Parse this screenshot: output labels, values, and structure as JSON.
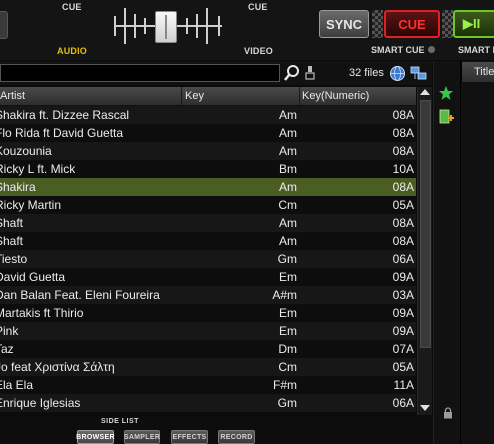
{
  "deck": {
    "cue_left_label": "CUE",
    "cue_right_label": "CUE",
    "audio_label": "AUDIO",
    "video_label": "VIDEO",
    "sync_label": "SYNC",
    "cue_button_label": "CUE",
    "play_button_label": "▶II",
    "smart_cue_label": "SMART CUE",
    "smart_cue_label_right": "SMART I",
    "colors": {
      "cue_red": "#e02020",
      "play_green": "#6cc82a",
      "audio_yellow": "#e8c000"
    }
  },
  "browser": {
    "search": {
      "value": "",
      "placeholder": ""
    },
    "files_count": "32 files",
    "columns": [
      "Artist",
      "Key",
      "Key(Numeric)"
    ],
    "rows": [
      {
        "artist": "Shakira ft. Dizzee Rascal",
        "key": "Am",
        "key_numeric": "08A"
      },
      {
        "artist": "Flo Rida ft David Guetta",
        "key": "Am",
        "key_numeric": "08A"
      },
      {
        "artist": "Kouzounia",
        "key": "Am",
        "key_numeric": "08A"
      },
      {
        "artist": "Ricky L ft. Mick",
        "key": "Bm",
        "key_numeric": "10A"
      },
      {
        "artist": "Shakira",
        "key": "Am",
        "key_numeric": "08A"
      },
      {
        "artist": "Ricky Martin",
        "key": "Cm",
        "key_numeric": "05A"
      },
      {
        "artist": "Shaft",
        "key": "Am",
        "key_numeric": "08A"
      },
      {
        "artist": "Shaft",
        "key": "Am",
        "key_numeric": "08A"
      },
      {
        "artist": "Tiesto",
        "key": "Gm",
        "key_numeric": "06A"
      },
      {
        "artist": "David Guetta",
        "key": "Em",
        "key_numeric": "09A"
      },
      {
        "artist": "Dan Balan Feat. Eleni Foureira",
        "key": "A#m",
        "key_numeric": "03A"
      },
      {
        "artist": "Martakis ft Thirio",
        "key": "Em",
        "key_numeric": "09A"
      },
      {
        "artist": "Pink",
        "key": "Em",
        "key_numeric": "09A"
      },
      {
        "artist": "Taz",
        "key": "Dm",
        "key_numeric": "07A"
      },
      {
        "artist": "Jo feat Χριστίνα Σάλτη",
        "key": "Cm",
        "key_numeric": "05A"
      },
      {
        "artist": "Ela Ela",
        "key": "F#m",
        "key_numeric": "11A"
      },
      {
        "artist": "Enrique Iglesias",
        "key": "Gm",
        "key_numeric": "06A"
      }
    ],
    "selected_row": 4,
    "colors": {
      "selected_row": "#4a5e24"
    }
  },
  "side_panel": {
    "column_header": "Title",
    "icons": [
      "star-icon",
      "add-to-list-icon",
      "lock-icon"
    ]
  },
  "bottom_bar": {
    "side_list_label": "SIDE LIST",
    "tabs": [
      "BROWSER",
      "SAMPLER",
      "EFFECTS",
      "RECORD"
    ]
  }
}
